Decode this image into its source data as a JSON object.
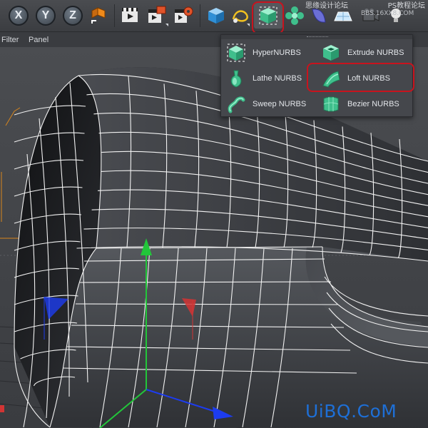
{
  "toolbar": {
    "axis_buttons": [
      "X",
      "Y",
      "Z"
    ],
    "watermark_left": "思缘设计论坛",
    "watermark_right": "PS教程论坛",
    "watermark_url": "BBS.16XX8.COM"
  },
  "menu": {
    "items": [
      "Filter",
      "Panel"
    ]
  },
  "nurbs_menu": {
    "items": [
      {
        "label": "HyperNURBS",
        "icon": "hypernurbs-icon"
      },
      {
        "label": "Extrude NURBS",
        "icon": "extrude-nurbs-icon"
      },
      {
        "label": "Lathe NURBS",
        "icon": "lathe-nurbs-icon"
      },
      {
        "label": "Loft NURBS",
        "icon": "loft-nurbs-icon"
      },
      {
        "label": "Sweep NURBS",
        "icon": "sweep-nurbs-icon"
      },
      {
        "label": "Bezier NURBS",
        "icon": "bezier-nurbs-icon"
      }
    ],
    "highlighted": "Loft NURBS"
  },
  "brand": "UiBQ.CoM",
  "colors": {
    "highlight_ring": "#c9131d",
    "nurbs_green": "#4fc9a0",
    "y_axis": "#22c63a",
    "brand_blue": "#1e6fd6"
  }
}
